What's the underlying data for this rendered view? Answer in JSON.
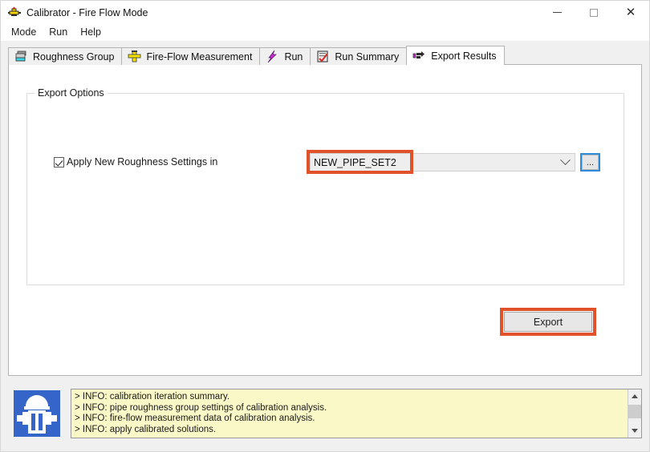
{
  "window": {
    "title": "Calibrator - Fire Flow Mode",
    "icon": "calibrator-app-icon",
    "controls": {
      "minimize": "–",
      "maximize": "□",
      "close": "✕"
    }
  },
  "menubar": {
    "items": [
      {
        "label": "Mode",
        "name": "menu-mode"
      },
      {
        "label": "Run",
        "name": "menu-run"
      },
      {
        "label": "Help",
        "name": "menu-help"
      }
    ]
  },
  "tabs": [
    {
      "label": "Roughness Group",
      "icon": "roughness-group-icon",
      "active": false
    },
    {
      "label": "Fire-Flow Measurement",
      "icon": "fire-hydrant-icon",
      "active": false
    },
    {
      "label": "Run",
      "icon": "lightning-bolt-icon",
      "active": false
    },
    {
      "label": "Run Summary",
      "icon": "report-check-icon",
      "active": false
    },
    {
      "label": "Export Results",
      "icon": "pointing-hand-icon",
      "active": true
    }
  ],
  "export_panel": {
    "group_label": "Export Options",
    "checkbox": {
      "label": "Apply New Roughness Settings in",
      "checked": true
    },
    "combo": {
      "value": "NEW_PIPE_SET2",
      "placeholder": "NEW_PIPE_SET2"
    },
    "browse_button_label": "...",
    "export_button_label": "Export"
  },
  "annotations": {
    "highlight_color": "#e2522a",
    "focus_color": "#2e8bd8"
  },
  "log": {
    "icon": "fire-hydrant-badge-icon",
    "lines": [
      "> INFO: calibration iteration summary.",
      "> INFO: pipe roughness group settings of calibration analysis.",
      "> INFO: fire-flow measurement data of calibration analysis.",
      "> INFO: apply calibrated solutions."
    ],
    "scrollbar": {
      "up_arrow": "scroll-up-arrow",
      "down_arrow": "scroll-down-arrow"
    }
  }
}
